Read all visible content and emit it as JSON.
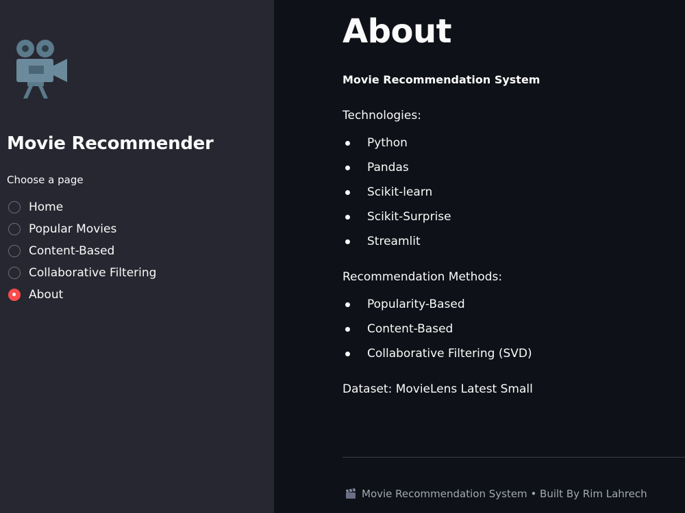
{
  "sidebar": {
    "logo_icon": "movie-camera-icon",
    "title": "Movie Recommender",
    "radio_label": "Choose a page",
    "options": [
      {
        "label": "Home",
        "selected": false
      },
      {
        "label": "Popular Movies",
        "selected": false
      },
      {
        "label": "Content-Based",
        "selected": false
      },
      {
        "label": "Collaborative Filtering",
        "selected": false
      },
      {
        "label": "About",
        "selected": true
      }
    ]
  },
  "main": {
    "title": "About",
    "subtitle": "Movie Recommendation System",
    "technologies_heading": "Technologies:",
    "technologies": [
      "Python",
      "Pandas",
      "Scikit-learn",
      "Scikit-Surprise",
      "Streamlit"
    ],
    "methods_heading": "Recommendation Methods:",
    "methods": [
      "Popularity-Based",
      "Content-Based",
      "Collaborative Filtering (SVD)"
    ],
    "dataset": "Dataset: MovieLens Latest Small"
  },
  "footer": {
    "icon": "clapperboard-icon",
    "text": "Movie Recommendation System • Built By Rim Lahrech"
  },
  "colors": {
    "sidebar_bg": "#262730",
    "main_bg": "#0e1117",
    "accent": "#ff4b4b"
  }
}
